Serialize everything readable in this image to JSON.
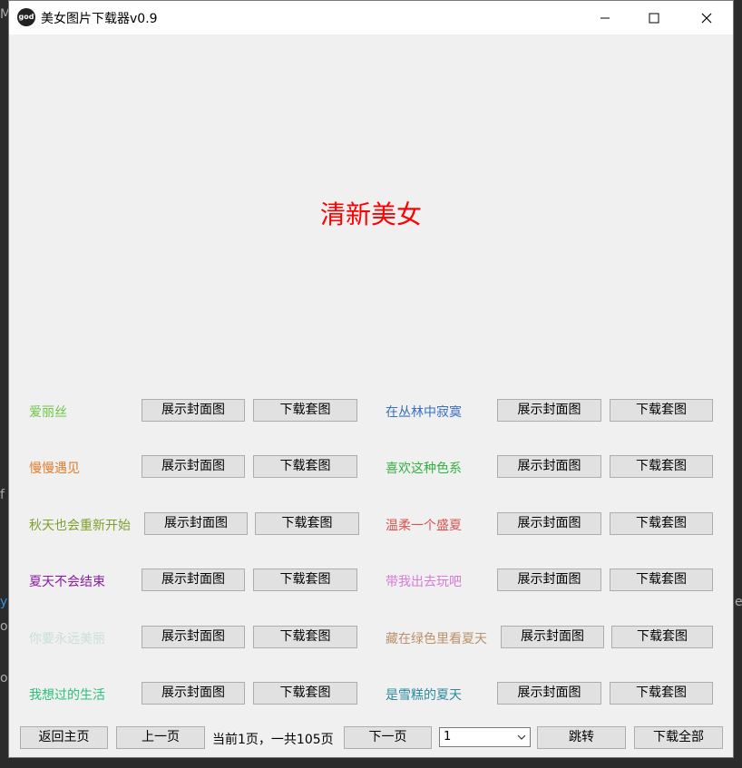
{
  "window": {
    "title": "美女图片下载器v0.9",
    "icon_text": "god",
    "controls": {
      "minimize": "minimize-icon",
      "maximize": "maximize-icon",
      "close": "close-icon"
    }
  },
  "heading": "清新美女",
  "buttons": {
    "show_cover": "展示封面图",
    "download_set": "下载套图"
  },
  "left_items": [
    {
      "label": "爱丽丝",
      "color": "#6cc644"
    },
    {
      "label": "慢慢遇见",
      "color": "#e07b2a"
    },
    {
      "label": "秋天也会重新开始",
      "color": "#7ea02c"
    },
    {
      "label": "夏天不会结束",
      "color": "#8a1aa8"
    },
    {
      "label": "你要永远美丽",
      "color": "#c9dfd4"
    },
    {
      "label": "我想过的生活",
      "color": "#2bc07a"
    }
  ],
  "right_items": [
    {
      "label": "在丛林中寂寞",
      "color": "#3a6fbf"
    },
    {
      "label": "喜欢这种色系",
      "color": "#33b040"
    },
    {
      "label": "温柔一个盛夏",
      "color": "#d9534f"
    },
    {
      "label": "带我出去玩吧",
      "color": "#d87ad8"
    },
    {
      "label": "藏在绿色里看夏天",
      "color": "#b9926a"
    },
    {
      "label": "是雪糕的夏天",
      "color": "#2a8a9e"
    }
  ],
  "footer": {
    "home": "返回主页",
    "prev": "上一页",
    "status": "当前1页，一共105页",
    "next": "下一页",
    "page_select": "1",
    "jump": "跳转",
    "download_all": "下载全部"
  },
  "background_fragments": [
    "M",
    "f",
    "y",
    "o",
    "o",
    "e"
  ]
}
